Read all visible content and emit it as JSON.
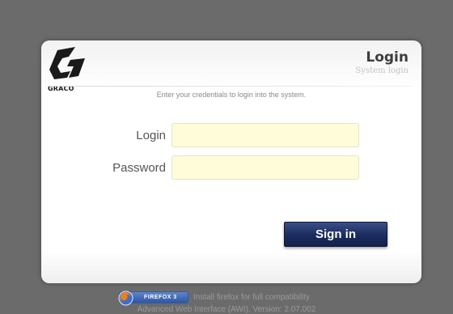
{
  "brand": {
    "logo_text": "GRACO"
  },
  "header": {
    "title": "Login",
    "subtitle": "System login"
  },
  "hint": "Enter your credentials to login into the system.",
  "form": {
    "login_label": "Login",
    "login_value": "",
    "password_label": "Password",
    "password_value": ""
  },
  "actions": {
    "signin_label": "Sign in"
  },
  "footer": {
    "badge_text": "FIREFOX 3",
    "firefox_note": "Install firefox for full compatibility",
    "version_text": "Advanced Web Interface (AWI), Version: 2.07.002"
  },
  "colors": {
    "background": "#6b6b6b",
    "button": "#1a2b5e",
    "field": "#fffdd9"
  },
  "icons": {
    "logo": "graco-logo",
    "firefox": "firefox-icon"
  }
}
